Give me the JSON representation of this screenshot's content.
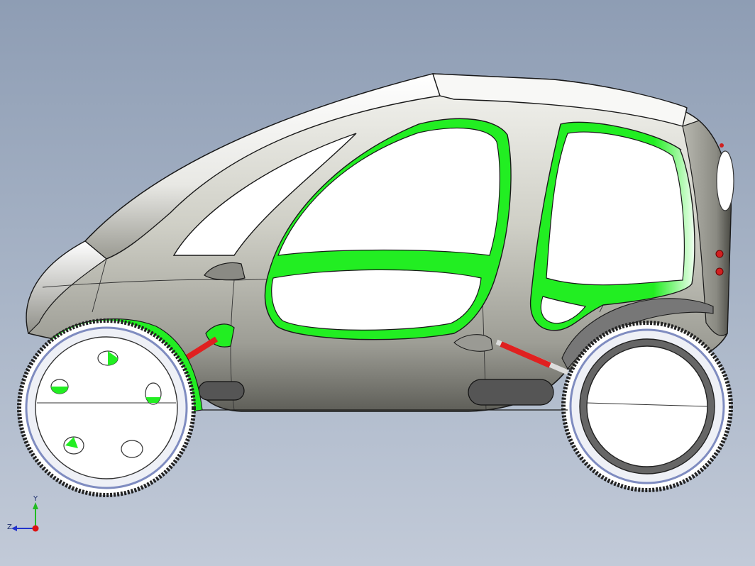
{
  "viewport": {
    "background_top": "#8e9db4",
    "background_bottom": "#c2cad8"
  },
  "model": {
    "body_color": "#d9d9d2",
    "seal_color": "#22ee22",
    "glass_color": "#ffffff",
    "damper_color": "#e02020",
    "edge_color": "#1a1a1a"
  },
  "triad": {
    "y_label": "Y",
    "z_label": "Z",
    "y_color": "#22bb22",
    "z_color": "#2233cc",
    "x_color": "#dd1111"
  }
}
